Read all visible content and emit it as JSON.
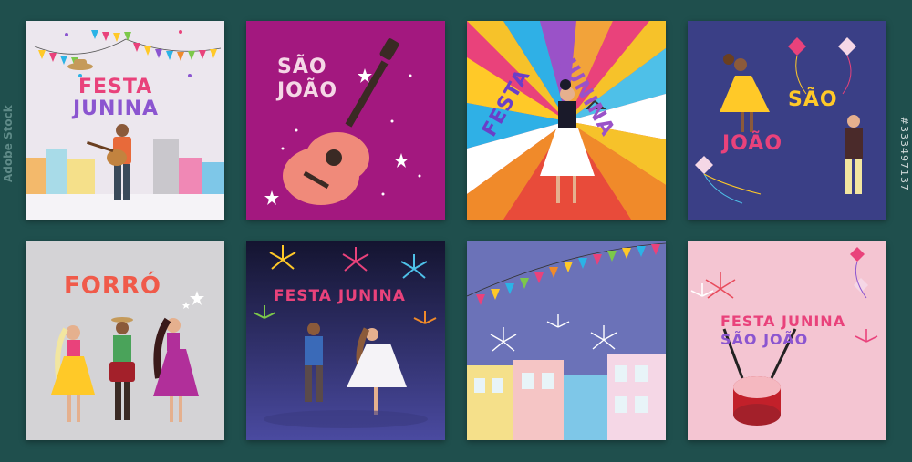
{
  "cards": [
    {
      "title_line1": "FESTA",
      "title_line2": "JUNINA",
      "bg": "#ece7ee"
    },
    {
      "title_line1": "SÃO",
      "title_line2": "JOÃO",
      "bg": "#a3187f"
    },
    {
      "title_line1": "FESTA",
      "title_line2": "JUNINA",
      "bg": "#e84b5c"
    },
    {
      "title_line1": "SÃO",
      "title_line2": "JOÃO",
      "bg": "#3a3f86"
    },
    {
      "title_line1": "FORRÓ",
      "bg": "#d4d3d6"
    },
    {
      "title_line1": "FESTA JUNINA",
      "bg": "#232450"
    },
    {
      "bg": "#6b72b8"
    },
    {
      "title_line1": "FESTA JUNINA",
      "title_line2": "SÃO JOÃO",
      "bg": "#f4c5d2"
    }
  ],
  "stock_id": "#333497137",
  "brand": "Adobe Stock"
}
